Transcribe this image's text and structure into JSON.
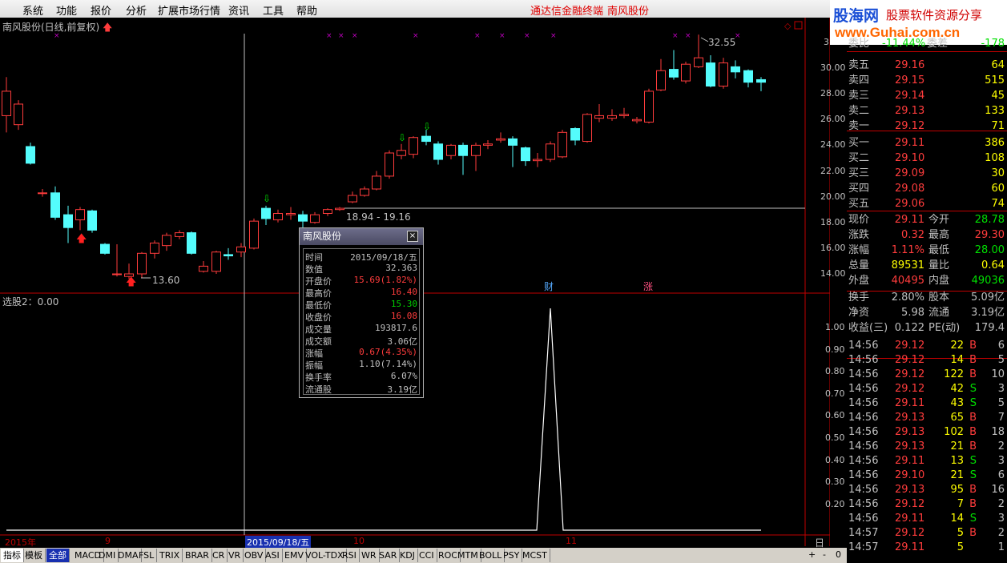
{
  "menu": {
    "items": [
      "系统",
      "功能",
      "报价",
      "分析",
      "扩展市场行情",
      "资讯",
      "工具",
      "帮助"
    ],
    "center1": "通达信金融终端",
    "center2": "南风股份"
  },
  "logo": {
    "brand": "股海网",
    "slogan": "股票软件资源分享",
    "url": "www.Guhai.com.cn"
  },
  "chart": {
    "title": "南风股份(日线,前复权)",
    "sub_label": "选股2：0.00",
    "price_axis": [
      "30.00",
      "28.00",
      "26.00",
      "24.00",
      "22.00",
      "20.00",
      "18.00",
      "16.00",
      "14.00"
    ],
    "price_axis_partial": "3",
    "ind_axis": [
      "1.00",
      "0.90",
      "0.80",
      "0.70",
      "0.60",
      "0.50",
      "0.40",
      "0.30",
      "0.20"
    ],
    "hi_label": "32.55",
    "lo_label": "13.60",
    "range_label": "18.94 - 19.16",
    "mark_cai": "财",
    "mark_zhang": "涨",
    "period": "日线"
  },
  "time_axis": {
    "year": "2015年",
    "m9": "9",
    "cursor": "2015/09/18/五",
    "m10": "10",
    "m11": "11"
  },
  "popup": {
    "title": "南风股份",
    "close": "×",
    "rows": [
      {
        "label": "时间",
        "value": "2015/09/18/五",
        "color": "#c0c0c0"
      },
      {
        "label": "数值",
        "value": "32.363",
        "color": "#c0c0c0"
      },
      {
        "label": "开盘价",
        "value": "15.69(1.82%)",
        "color": "#ff3c3c"
      },
      {
        "label": "最高价",
        "value": "16.40",
        "color": "#ff3c3c"
      },
      {
        "label": "最低价",
        "value": "15.30",
        "color": "#00d000"
      },
      {
        "label": "收盘价",
        "value": "16.08",
        "color": "#ff3c3c"
      },
      {
        "label": "成交量",
        "value": "193817.6",
        "color": "#c0c0c0"
      },
      {
        "label": "成交额",
        "value": "3.06亿",
        "color": "#c0c0c0"
      },
      {
        "label": "涨幅",
        "value": "0.67(4.35%)",
        "color": "#ff3c3c"
      },
      {
        "label": "振幅",
        "value": "1.10(7.14%)",
        "color": "#c0c0c0"
      },
      {
        "label": "换手率",
        "value": "6.07%",
        "color": "#c0c0c0"
      },
      {
        "label": "流通股",
        "value": "3.19亿",
        "color": "#c0c0c0"
      }
    ]
  },
  "quote": {
    "header": {
      "l1": "委比",
      "v1": "-11.44%",
      "l2": "委差",
      "v2": "-178"
    },
    "sell": [
      {
        "label": "卖五",
        "price": "29.16",
        "vol": "64"
      },
      {
        "label": "卖四",
        "price": "29.15",
        "vol": "515"
      },
      {
        "label": "卖三",
        "price": "29.14",
        "vol": "45"
      },
      {
        "label": "卖二",
        "price": "29.13",
        "vol": "133"
      },
      {
        "label": "卖一",
        "price": "29.12",
        "vol": "71"
      }
    ],
    "buy": [
      {
        "label": "买一",
        "price": "29.11",
        "vol": "386"
      },
      {
        "label": "买二",
        "price": "29.10",
        "vol": "108"
      },
      {
        "label": "买三",
        "price": "29.09",
        "vol": "30"
      },
      {
        "label": "买四",
        "price": "29.08",
        "vol": "60"
      },
      {
        "label": "买五",
        "price": "29.06",
        "vol": "74"
      }
    ],
    "stats": [
      {
        "l1": "现价",
        "v1": "29.11",
        "c1": "#ff3c3c",
        "l2": "今开",
        "v2": "28.78",
        "c2": "#00e000"
      },
      {
        "l1": "涨跌",
        "v1": "0.32",
        "c1": "#ff3c3c",
        "l2": "最高",
        "v2": "29.30",
        "c2": "#ff3c3c"
      },
      {
        "l1": "涨幅",
        "v1": "1.11%",
        "c1": "#ff3c3c",
        "l2": "最低",
        "v2": "28.00",
        "c2": "#00e000"
      },
      {
        "l1": "总量",
        "v1": "89531",
        "c1": "#ffff00",
        "l2": "量比",
        "v2": "0.64",
        "c2": "#ffff00"
      },
      {
        "l1": "外盘",
        "v1": "40495",
        "c1": "#ff3c3c",
        "l2": "内盘",
        "v2": "49036",
        "c2": "#00e000"
      }
    ],
    "stats2": [
      {
        "l1": "换手",
        "v1": "2.80%",
        "l2": "股本",
        "v2": "5.09亿"
      },
      {
        "l1": "净资",
        "v1": "5.98",
        "l2": "流通",
        "v2": "3.19亿"
      },
      {
        "l1": "收益(三)",
        "v1": "0.122",
        "l2": "PE(动)",
        "v2": "179.4"
      }
    ],
    "ticks": [
      {
        "t": "14:56",
        "p": "29.12",
        "pc": "#ff3c3c",
        "v": "22",
        "s": "B",
        "n": "6"
      },
      {
        "t": "14:56",
        "p": "29.12",
        "pc": "#ff3c3c",
        "v": "14",
        "s": "B",
        "n": "5"
      },
      {
        "t": "14:56",
        "p": "29.12",
        "pc": "#ff3c3c",
        "v": "122",
        "s": "B",
        "n": "10"
      },
      {
        "t": "14:56",
        "p": "29.12",
        "pc": "#ff3c3c",
        "v": "42",
        "s": "S",
        "n": "3"
      },
      {
        "t": "14:56",
        "p": "29.11",
        "pc": "#ff3c3c",
        "v": "43",
        "s": "S",
        "n": "5"
      },
      {
        "t": "14:56",
        "p": "29.13",
        "pc": "#ff3c3c",
        "v": "65",
        "s": "B",
        "n": "7"
      },
      {
        "t": "14:56",
        "p": "29.13",
        "pc": "#ff3c3c",
        "v": "102",
        "s": "B",
        "n": "18"
      },
      {
        "t": "14:56",
        "p": "29.13",
        "pc": "#ff3c3c",
        "v": "21",
        "s": "B",
        "n": "2"
      },
      {
        "t": "14:56",
        "p": "29.11",
        "pc": "#ff3c3c",
        "v": "13",
        "s": "S",
        "n": "3"
      },
      {
        "t": "14:56",
        "p": "29.10",
        "pc": "#ff3c3c",
        "v": "21",
        "s": "S",
        "n": "6"
      },
      {
        "t": "14:56",
        "p": "29.13",
        "pc": "#ff3c3c",
        "v": "95",
        "s": "B",
        "n": "16"
      },
      {
        "t": "14:56",
        "p": "29.12",
        "pc": "#ff3c3c",
        "v": "7",
        "s": "B",
        "n": "2"
      },
      {
        "t": "14:56",
        "p": "29.11",
        "pc": "#ff3c3c",
        "v": "14",
        "s": "S",
        "n": "3"
      },
      {
        "t": "14:57",
        "p": "29.12",
        "pc": "#ff3c3c",
        "v": "5",
        "s": "B",
        "n": "2"
      },
      {
        "t": "14:57",
        "p": "29.11",
        "pc": "#ff3c3c",
        "v": "5",
        "s": "",
        "n": "1"
      }
    ]
  },
  "tabs": [
    "指标",
    "模板",
    "全部",
    "MACD",
    "DMI",
    "DMA",
    "FSL",
    "TRIX",
    "BRAR",
    "CR",
    "VR",
    "OBV",
    "ASI",
    "EMV",
    "VOL-TDX",
    "RSI",
    "WR",
    "SAR",
    "KDJ",
    "CCI",
    "ROC",
    "MTM",
    "BOLL",
    "PSY",
    "MCST"
  ],
  "colors": {
    "up": "#ff3c3c",
    "down": "#54fcfc",
    "grid": "#c00000"
  }
}
